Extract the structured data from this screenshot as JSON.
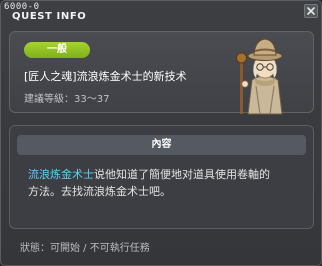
{
  "window": {
    "id_label": "6000-0",
    "title": "QUEST INFO"
  },
  "quest": {
    "category_badge": "一般",
    "name": "[匠人之魂]流浪炼金术士的新技术",
    "level_range": "建議等級：33～37"
  },
  "content": {
    "header": "內容",
    "npc_name": "流浪炼金术士",
    "line1_rest": "说他知道了簡便地对道具使用卷軸的",
    "line2": "方法。去找流浪炼金术士吧。"
  },
  "status": {
    "text": "狀態：可開始 / 不可執行任務"
  },
  "colors": {
    "badge_green": "#8dc224",
    "npc_link": "#5fd0ee",
    "window_bg": "#3a3c40"
  },
  "icons": {
    "close": "close-icon",
    "npc": "npc-portrait-icon"
  }
}
